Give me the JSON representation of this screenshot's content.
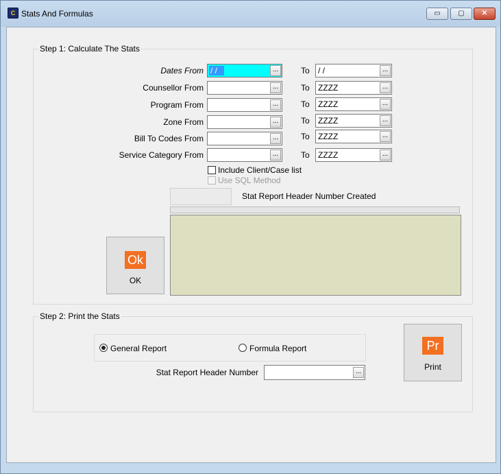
{
  "window": {
    "title": "Stats And Formulas",
    "icon": "app-logo-icon",
    "controls": {
      "minimize": "▭",
      "maximize": "▢",
      "close": "✕"
    }
  },
  "step1": {
    "title": "Step 1: Calculate The Stats",
    "to_label": "To",
    "rows": [
      {
        "label": "Dates From",
        "from_value": "/ /",
        "to_value": " / /"
      },
      {
        "label": "Counsellor From",
        "from_value": "",
        "to_value": "ZZZZ"
      },
      {
        "label": "Program From",
        "from_value": "",
        "to_value": "ZZZZ"
      },
      {
        "label": "Zone From",
        "from_value": "",
        "to_value": "ZZZZ"
      },
      {
        "label": "Bill To Codes From",
        "from_value": "",
        "to_value": "ZZZZ"
      },
      {
        "label": "Service Category From",
        "from_value": "",
        "to_value": "ZZZZ"
      }
    ],
    "lookup_glyph": "...",
    "include_client_case": {
      "label": "Include Client/Case list",
      "checked": false
    },
    "use_sql": {
      "label": "Use SQL Method",
      "checked": false,
      "enabled": false
    },
    "header_created_label": "Stat Report Header Number Created",
    "header_created_value": "",
    "ok_button": {
      "icon_text": "Ok",
      "label": "OK"
    }
  },
  "step2": {
    "title": "Step 2: Print the Stats",
    "report_type": {
      "options": [
        "General Report",
        "Formula Report"
      ],
      "selected": "General Report"
    },
    "header_number_label": "Stat Report Header Number",
    "header_number_value": "",
    "print_button": {
      "icon_text": "Pr",
      "label": "Print"
    }
  },
  "colors": {
    "accent_orange": "#f36f21",
    "highlight_field": "#00ffff",
    "memo_bg": "#dedfc0",
    "title_bar": "#c5d9ed"
  }
}
